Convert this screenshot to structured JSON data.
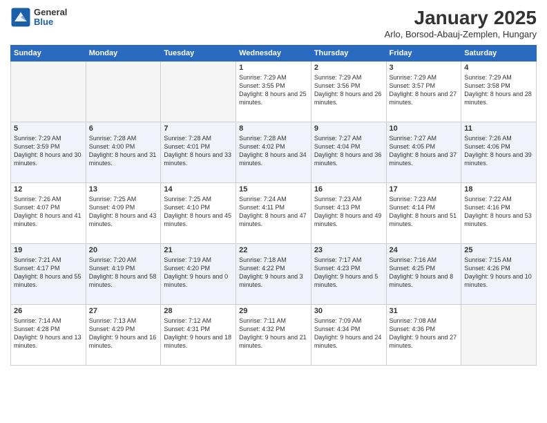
{
  "logo": {
    "general": "General",
    "blue": "Blue"
  },
  "title": "January 2025",
  "subtitle": "Arlo, Borsod-Abauj-Zemplen, Hungary",
  "headers": [
    "Sunday",
    "Monday",
    "Tuesday",
    "Wednesday",
    "Thursday",
    "Friday",
    "Saturday"
  ],
  "weeks": [
    [
      {
        "date": "",
        "sunrise": "",
        "sunset": "",
        "daylight": "",
        "empty": true
      },
      {
        "date": "",
        "sunrise": "",
        "sunset": "",
        "daylight": "",
        "empty": true
      },
      {
        "date": "",
        "sunrise": "",
        "sunset": "",
        "daylight": "",
        "empty": true
      },
      {
        "date": "1",
        "sunrise": "Sunrise: 7:29 AM",
        "sunset": "Sunset: 3:55 PM",
        "daylight": "Daylight: 8 hours and 25 minutes.",
        "empty": false
      },
      {
        "date": "2",
        "sunrise": "Sunrise: 7:29 AM",
        "sunset": "Sunset: 3:56 PM",
        "daylight": "Daylight: 8 hours and 26 minutes.",
        "empty": false
      },
      {
        "date": "3",
        "sunrise": "Sunrise: 7:29 AM",
        "sunset": "Sunset: 3:57 PM",
        "daylight": "Daylight: 8 hours and 27 minutes.",
        "empty": false
      },
      {
        "date": "4",
        "sunrise": "Sunrise: 7:29 AM",
        "sunset": "Sunset: 3:58 PM",
        "daylight": "Daylight: 8 hours and 28 minutes.",
        "empty": false
      }
    ],
    [
      {
        "date": "5",
        "sunrise": "Sunrise: 7:29 AM",
        "sunset": "Sunset: 3:59 PM",
        "daylight": "Daylight: 8 hours and 30 minutes.",
        "empty": false
      },
      {
        "date": "6",
        "sunrise": "Sunrise: 7:28 AM",
        "sunset": "Sunset: 4:00 PM",
        "daylight": "Daylight: 8 hours and 31 minutes.",
        "empty": false
      },
      {
        "date": "7",
        "sunrise": "Sunrise: 7:28 AM",
        "sunset": "Sunset: 4:01 PM",
        "daylight": "Daylight: 8 hours and 33 minutes.",
        "empty": false
      },
      {
        "date": "8",
        "sunrise": "Sunrise: 7:28 AM",
        "sunset": "Sunset: 4:02 PM",
        "daylight": "Daylight: 8 hours and 34 minutes.",
        "empty": false
      },
      {
        "date": "9",
        "sunrise": "Sunrise: 7:27 AM",
        "sunset": "Sunset: 4:04 PM",
        "daylight": "Daylight: 8 hours and 36 minutes.",
        "empty": false
      },
      {
        "date": "10",
        "sunrise": "Sunrise: 7:27 AM",
        "sunset": "Sunset: 4:05 PM",
        "daylight": "Daylight: 8 hours and 37 minutes.",
        "empty": false
      },
      {
        "date": "11",
        "sunrise": "Sunrise: 7:26 AM",
        "sunset": "Sunset: 4:06 PM",
        "daylight": "Daylight: 8 hours and 39 minutes.",
        "empty": false
      }
    ],
    [
      {
        "date": "12",
        "sunrise": "Sunrise: 7:26 AM",
        "sunset": "Sunset: 4:07 PM",
        "daylight": "Daylight: 8 hours and 41 minutes.",
        "empty": false
      },
      {
        "date": "13",
        "sunrise": "Sunrise: 7:25 AM",
        "sunset": "Sunset: 4:09 PM",
        "daylight": "Daylight: 8 hours and 43 minutes.",
        "empty": false
      },
      {
        "date": "14",
        "sunrise": "Sunrise: 7:25 AM",
        "sunset": "Sunset: 4:10 PM",
        "daylight": "Daylight: 8 hours and 45 minutes.",
        "empty": false
      },
      {
        "date": "15",
        "sunrise": "Sunrise: 7:24 AM",
        "sunset": "Sunset: 4:11 PM",
        "daylight": "Daylight: 8 hours and 47 minutes.",
        "empty": false
      },
      {
        "date": "16",
        "sunrise": "Sunrise: 7:23 AM",
        "sunset": "Sunset: 4:13 PM",
        "daylight": "Daylight: 8 hours and 49 minutes.",
        "empty": false
      },
      {
        "date": "17",
        "sunrise": "Sunrise: 7:23 AM",
        "sunset": "Sunset: 4:14 PM",
        "daylight": "Daylight: 8 hours and 51 minutes.",
        "empty": false
      },
      {
        "date": "18",
        "sunrise": "Sunrise: 7:22 AM",
        "sunset": "Sunset: 4:16 PM",
        "daylight": "Daylight: 8 hours and 53 minutes.",
        "empty": false
      }
    ],
    [
      {
        "date": "19",
        "sunrise": "Sunrise: 7:21 AM",
        "sunset": "Sunset: 4:17 PM",
        "daylight": "Daylight: 8 hours and 55 minutes.",
        "empty": false
      },
      {
        "date": "20",
        "sunrise": "Sunrise: 7:20 AM",
        "sunset": "Sunset: 4:19 PM",
        "daylight": "Daylight: 8 hours and 58 minutes.",
        "empty": false
      },
      {
        "date": "21",
        "sunrise": "Sunrise: 7:19 AM",
        "sunset": "Sunset: 4:20 PM",
        "daylight": "Daylight: 9 hours and 0 minutes.",
        "empty": false
      },
      {
        "date": "22",
        "sunrise": "Sunrise: 7:18 AM",
        "sunset": "Sunset: 4:22 PM",
        "daylight": "Daylight: 9 hours and 3 minutes.",
        "empty": false
      },
      {
        "date": "23",
        "sunrise": "Sunrise: 7:17 AM",
        "sunset": "Sunset: 4:23 PM",
        "daylight": "Daylight: 9 hours and 5 minutes.",
        "empty": false
      },
      {
        "date": "24",
        "sunrise": "Sunrise: 7:16 AM",
        "sunset": "Sunset: 4:25 PM",
        "daylight": "Daylight: 9 hours and 8 minutes.",
        "empty": false
      },
      {
        "date": "25",
        "sunrise": "Sunrise: 7:15 AM",
        "sunset": "Sunset: 4:26 PM",
        "daylight": "Daylight: 9 hours and 10 minutes.",
        "empty": false
      }
    ],
    [
      {
        "date": "26",
        "sunrise": "Sunrise: 7:14 AM",
        "sunset": "Sunset: 4:28 PM",
        "daylight": "Daylight: 9 hours and 13 minutes.",
        "empty": false
      },
      {
        "date": "27",
        "sunrise": "Sunrise: 7:13 AM",
        "sunset": "Sunset: 4:29 PM",
        "daylight": "Daylight: 9 hours and 16 minutes.",
        "empty": false
      },
      {
        "date": "28",
        "sunrise": "Sunrise: 7:12 AM",
        "sunset": "Sunset: 4:31 PM",
        "daylight": "Daylight: 9 hours and 18 minutes.",
        "empty": false
      },
      {
        "date": "29",
        "sunrise": "Sunrise: 7:11 AM",
        "sunset": "Sunset: 4:32 PM",
        "daylight": "Daylight: 9 hours and 21 minutes.",
        "empty": false
      },
      {
        "date": "30",
        "sunrise": "Sunrise: 7:09 AM",
        "sunset": "Sunset: 4:34 PM",
        "daylight": "Daylight: 9 hours and 24 minutes.",
        "empty": false
      },
      {
        "date": "31",
        "sunrise": "Sunrise: 7:08 AM",
        "sunset": "Sunset: 4:36 PM",
        "daylight": "Daylight: 9 hours and 27 minutes.",
        "empty": false
      },
      {
        "date": "",
        "sunrise": "",
        "sunset": "",
        "daylight": "",
        "empty": true
      }
    ]
  ]
}
